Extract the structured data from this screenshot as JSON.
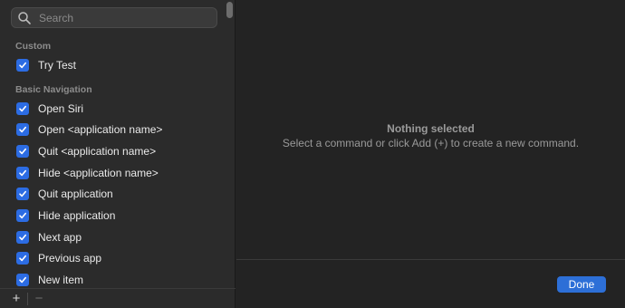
{
  "search": {
    "placeholder": "Search"
  },
  "sections": [
    {
      "header": "Custom",
      "items": [
        {
          "label": "Try Test",
          "checked": true
        }
      ]
    },
    {
      "header": "Basic Navigation",
      "items": [
        {
          "label": "Open Siri",
          "checked": true
        },
        {
          "label": "Open <application name>",
          "checked": true
        },
        {
          "label": "Quit <application name>",
          "checked": true
        },
        {
          "label": "Hide <application name>",
          "checked": true
        },
        {
          "label": "Quit application",
          "checked": true
        },
        {
          "label": "Hide application",
          "checked": true
        },
        {
          "label": "Next app",
          "checked": true
        },
        {
          "label": "Previous app",
          "checked": true
        },
        {
          "label": "New item",
          "checked": true
        }
      ]
    }
  ],
  "footer": {
    "add": "+",
    "remove": "−"
  },
  "detail": {
    "title": "Nothing selected",
    "subtitle": "Select a command or click Add (+) to create a new command."
  },
  "done_label": "Done",
  "colors": {
    "accent": "#2c6ce3",
    "button": "#2d6fd7"
  }
}
